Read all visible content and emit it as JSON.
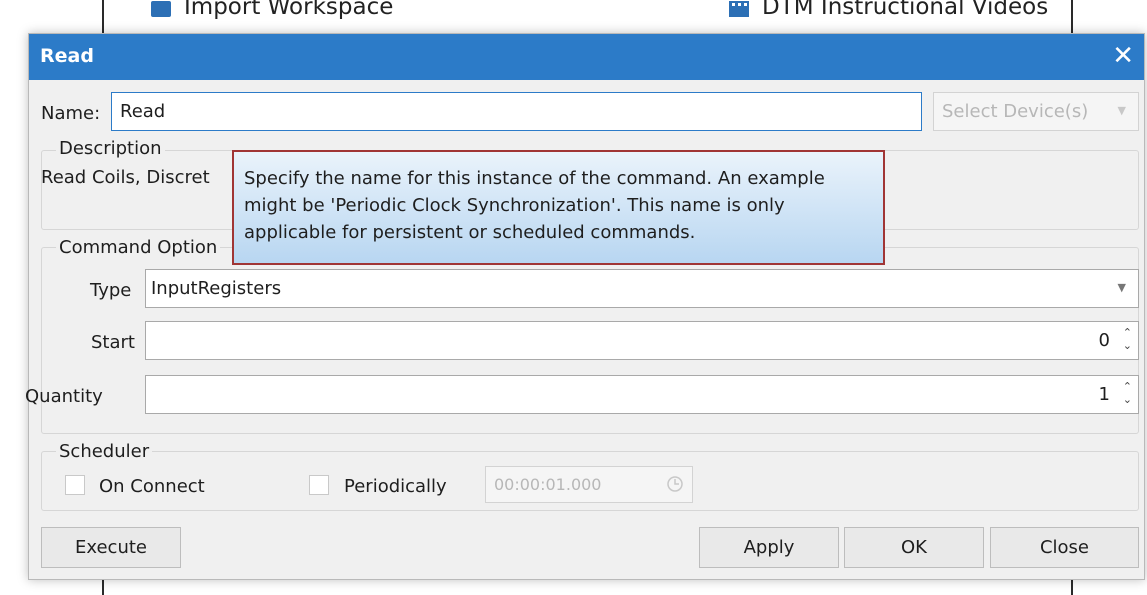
{
  "background": {
    "import_workspace": "Import Workspace",
    "dtm_videos": "DTM Instructional Videos"
  },
  "dialog": {
    "title": "Read",
    "close_glyph": "✕",
    "name_label": "Name:",
    "name_value": "Read",
    "select_devices": "Select Device(s)",
    "description_title": "Description",
    "description_text": "Read Coils, Discret",
    "command_options_title": "Command Option",
    "type_label": "Type",
    "type_value": "InputRegisters",
    "start_label": "Start",
    "start_value": "0",
    "quantity_label": "Quantity",
    "quantity_value": "1",
    "scheduler_title": "Scheduler",
    "on_connect_label": "On Connect",
    "periodically_label": "Periodically",
    "interval_value": "00:00:01.000",
    "buttons": {
      "execute": "Execute",
      "apply": "Apply",
      "ok": "OK",
      "close": "Close"
    }
  },
  "tooltip": {
    "line1": "Specify the name for this instance of the command. An example",
    "line2": "might be 'Periodic Clock Synchronization'. This name is only",
    "line3": "applicable for persistent or scheduled commands."
  },
  "colors": {
    "title_bar": "#2c7bc8",
    "tooltip_border": "#a03535"
  }
}
